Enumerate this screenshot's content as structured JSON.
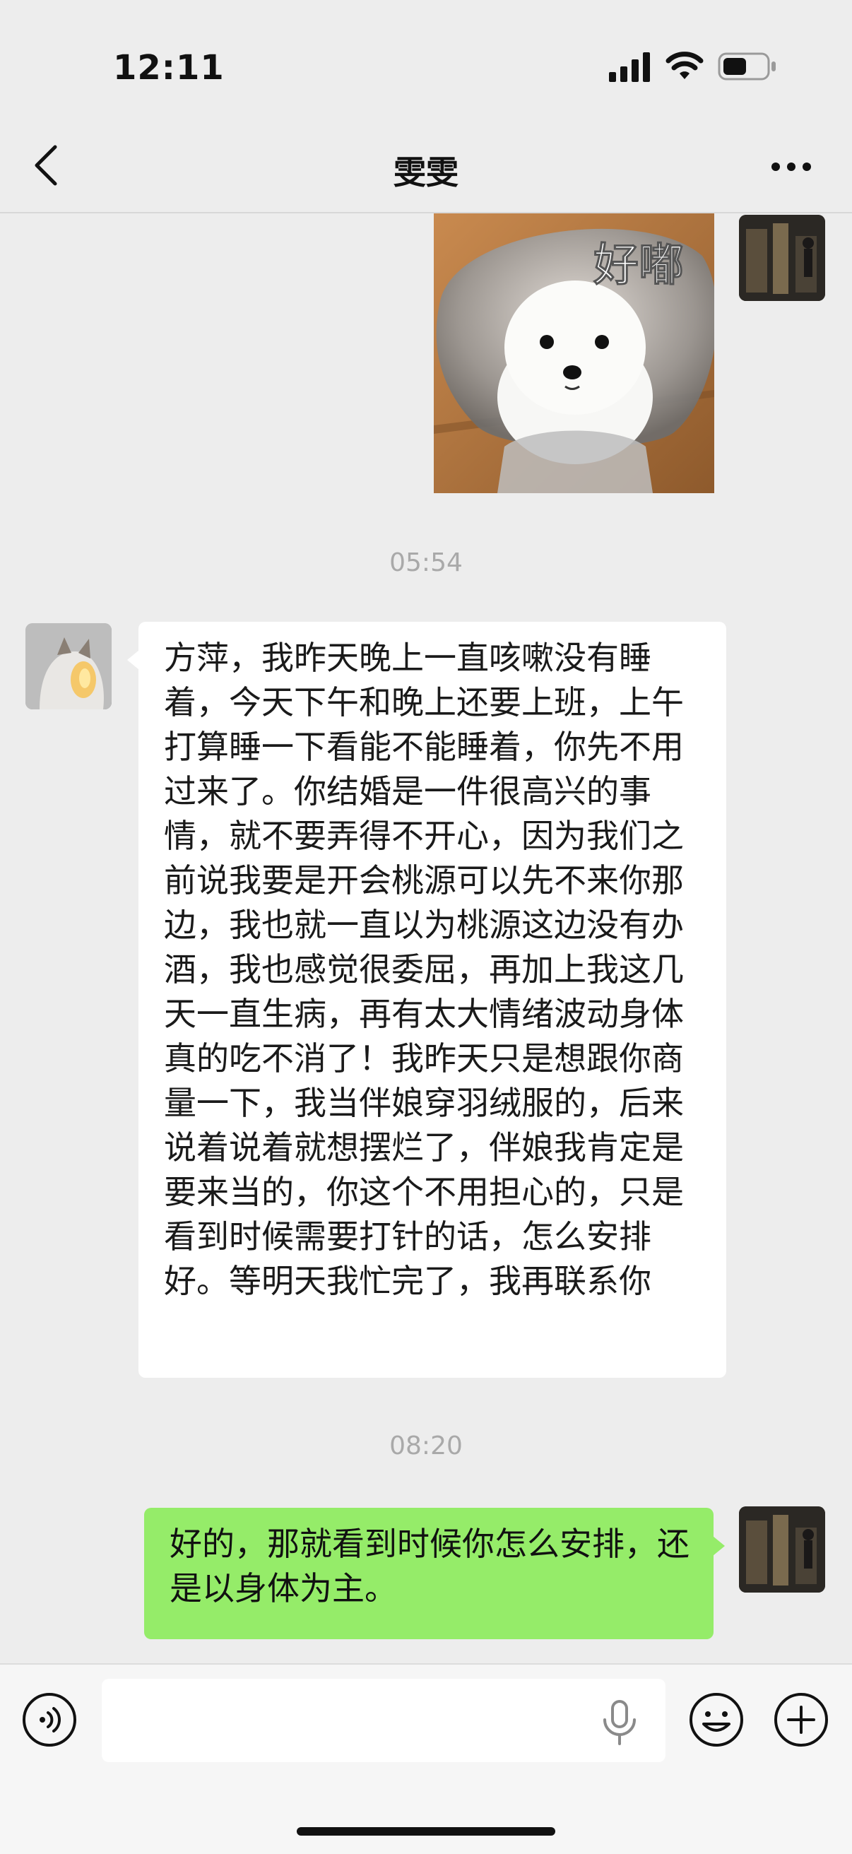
{
  "status_bar": {
    "time": "12:11"
  },
  "header": {
    "title": "雯雯"
  },
  "messages": [
    {
      "type": "sticker",
      "from": "me",
      "sticker_text": "好嘟"
    },
    {
      "type": "timestamp",
      "text": "05:54"
    },
    {
      "type": "text",
      "from": "other",
      "text": "方萍，我昨天晚上一直咳嗽没有睡着，今天下午和晚上还要上班，上午打算睡一下看能不能睡着，你先不用过来了。你结婚是一件很高兴的事情，就不要弄得不开心，因为我们之前说我要是开会桃源可以先不来你那边，我也就一直以为桃源这边没有办酒，我也感觉很委屈，再加上我这几天一直生病，再有太大情绪波动身体真的吃不消了！我昨天只是想跟你商量一下，我当伴娘穿羽绒服的，后来说着说着就想摆烂了，伴娘我肯定是要来当的，你这个不用担心的，只是看到时候需要打针的话，怎么安排好。等明天我忙完了，我再联系你"
    },
    {
      "type": "timestamp",
      "text": "08:20"
    },
    {
      "type": "text",
      "from": "me",
      "text": "好的，那就看到时候你怎么安排，还是以身体为主。"
    }
  ],
  "colors": {
    "background": "#ededed",
    "my_bubble": "#95ec69",
    "other_bubble": "#ffffff",
    "timestamp": "#a9a9a9"
  },
  "icons": [
    "back-icon",
    "more-icon",
    "voice-icon",
    "microphone-icon",
    "emoji-icon",
    "plus-icon",
    "signal-icon",
    "wifi-icon",
    "battery-icon"
  ]
}
